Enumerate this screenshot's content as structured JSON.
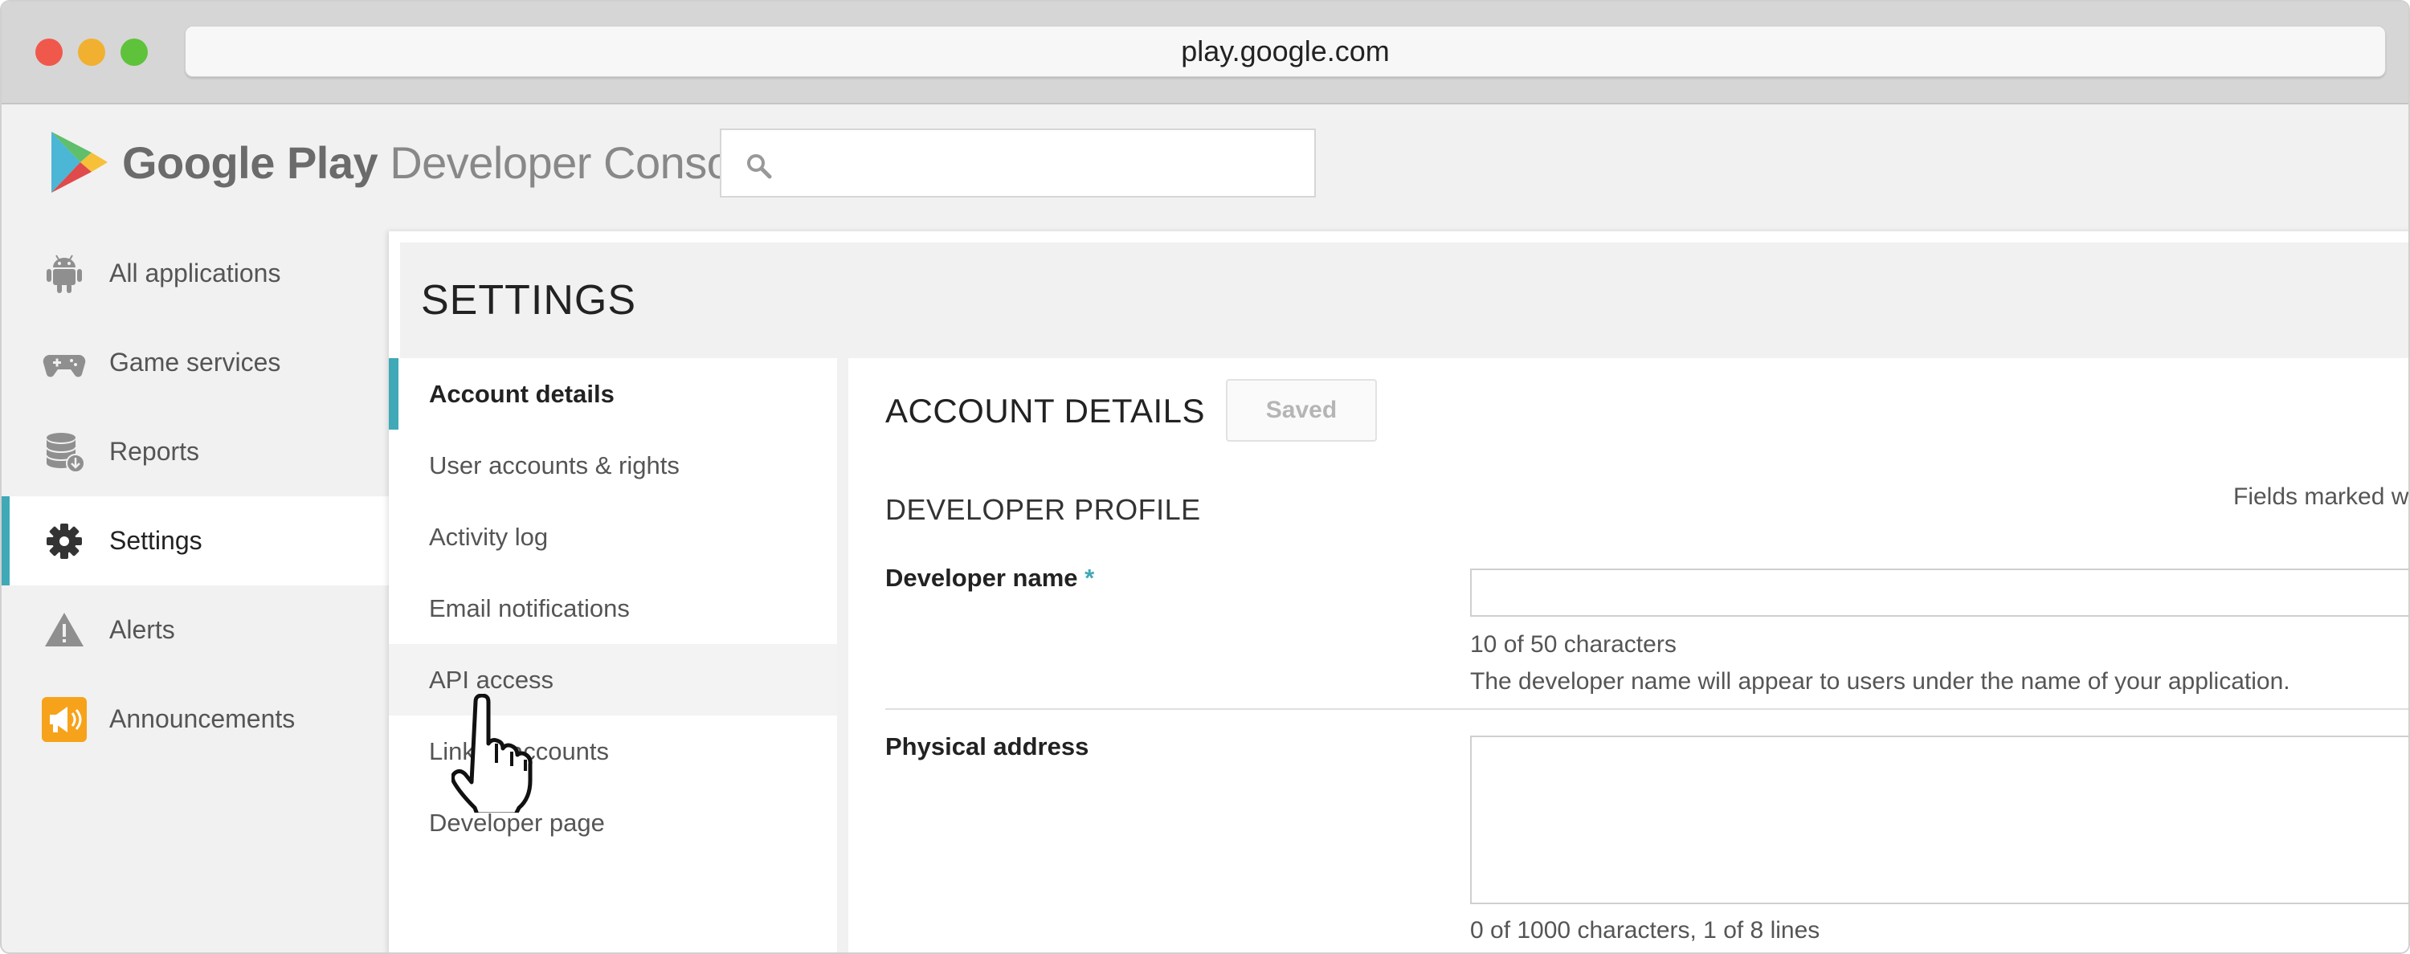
{
  "browser": {
    "url": "play.google.com"
  },
  "header": {
    "logo_brand": "Google Play",
    "logo_product": "Developer Console",
    "search": {
      "placeholder": "",
      "value": ""
    }
  },
  "leftnav": {
    "items": [
      {
        "label": "All applications",
        "icon": "android-icon",
        "active": false
      },
      {
        "label": "Game services",
        "icon": "gamepad-icon",
        "active": false
      },
      {
        "label": "Reports",
        "icon": "database-download-icon",
        "active": false
      },
      {
        "label": "Settings",
        "icon": "gear-icon",
        "active": true
      },
      {
        "label": "Alerts",
        "icon": "warning-icon",
        "active": false
      },
      {
        "label": "Announcements",
        "icon": "megaphone-icon",
        "active": false
      }
    ]
  },
  "settings": {
    "title": "SETTINGS",
    "subnav": [
      {
        "label": "Account details",
        "active": true
      },
      {
        "label": "User accounts & rights"
      },
      {
        "label": "Activity log"
      },
      {
        "label": "Email notifications"
      },
      {
        "label": "API access",
        "hover": true
      },
      {
        "label": "Linked accounts"
      },
      {
        "label": "Developer page"
      }
    ]
  },
  "account": {
    "title": "ACCOUNT DETAILS",
    "saved_label": "Saved",
    "profile_title": "DEVELOPER PROFILE",
    "fields_note": "Fields marked w",
    "developer_name": {
      "label": "Developer name",
      "required_mark": "*",
      "value": "",
      "count": "10 of 50 characters",
      "help": "The developer name will appear to users under the name of your application."
    },
    "physical_address": {
      "label": "Physical address",
      "value": "",
      "count": "0 of 1000 characters, 1 of 8 lines"
    }
  },
  "colors": {
    "accent": "#3fa9b8",
    "background": "#f1f1f1",
    "announcement_icon": "#f7a21b"
  }
}
